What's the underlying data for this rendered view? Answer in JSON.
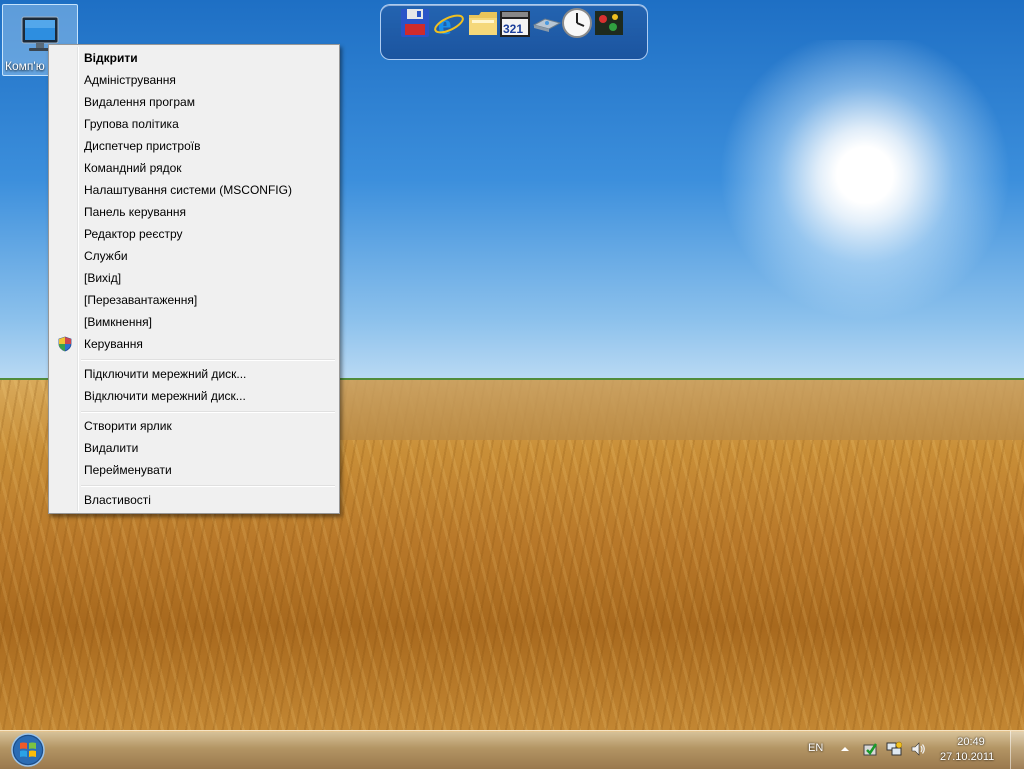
{
  "desktop": {
    "computer_icon_label": "Комп'ю"
  },
  "dock": {
    "items": [
      "floppy-save-icon",
      "ie-icon",
      "folder-icon",
      "media-player-321-icon",
      "network-icon",
      "clock-icon",
      "media-center-icon"
    ]
  },
  "context_menu": {
    "items": [
      {
        "label": "Відкрити",
        "bold": true
      },
      {
        "label": "Адміністрування"
      },
      {
        "label": "Видалення програм"
      },
      {
        "label": "Групова політика"
      },
      {
        "label": "Диспетчер пристроїв"
      },
      {
        "label": "Командний рядок"
      },
      {
        "label": "Налаштування системи (MSCONFIG)"
      },
      {
        "label": "Панель керування"
      },
      {
        "label": "Редактор реєстру"
      },
      {
        "label": "Служби"
      },
      {
        "label": "[Вихід]"
      },
      {
        "label": "[Перезавантаження]"
      },
      {
        "label": "[Вимкнення]"
      },
      {
        "label": "Керування",
        "icon": "shield-icon"
      },
      {
        "label": "Підключити мережний диск..."
      },
      {
        "label": "Відключити мережний диск..."
      },
      {
        "label": "Створити ярлик"
      },
      {
        "label": "Видалити"
      },
      {
        "label": "Перейменувати"
      },
      {
        "label": "Властивості"
      }
    ]
  },
  "taskbar": {
    "language": "EN",
    "time": "20:49",
    "date": "27.10.2011",
    "tray_icons": [
      "show-hidden-icons-arrow",
      "action-center-icon",
      "network-icon",
      "volume-icon"
    ]
  },
  "colors": {
    "menu_background": "#f0f0f0",
    "menu_border": "#979797",
    "taskbar": "#c39a5e"
  }
}
